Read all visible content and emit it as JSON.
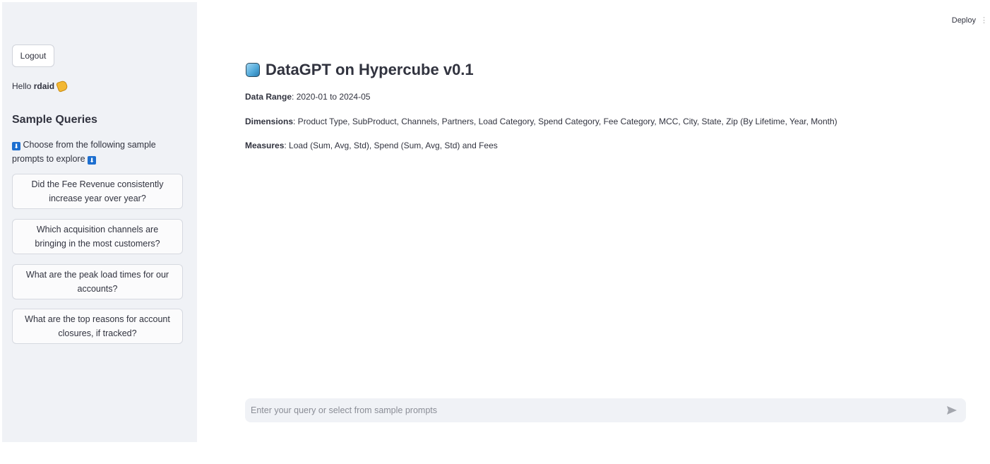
{
  "header": {
    "deploy_label": "Deploy",
    "menu_glyph": "⋮"
  },
  "sidebar": {
    "logout_label": "Logout",
    "greeting_prefix": "Hello ",
    "username": "rdaid",
    "greeting_icon": "waving-hand-icon",
    "section_title": "Sample Queries",
    "instruction_icon": "down-arrow-icon",
    "instruction": " Choose from the following sample prompts to explore ",
    "sample_prompts": [
      "Did the Fee Revenue consistently increase year over year?",
      "Which acquisition channels are bringing in the most customers?",
      "What are the peak load times for our accounts?",
      "What are the top reasons for account closures, if tracked?"
    ]
  },
  "main": {
    "title_icon": "cube-icon",
    "title": "DataGPT on Hypercube v0.1",
    "data_range_label": "Data Range",
    "data_range_value": ": 2020-01 to 2024-05",
    "dimensions_label": "Dimensions",
    "dimensions_value": ": Product Type, SubProduct, Channels, Partners, Load Category, Spend Category, Fee Category, MCC, City, State, Zip (By Lifetime, Year, Month)",
    "measures_label": "Measures",
    "measures_value": ": Load (Sum, Avg, Std), Spend (Sum, Avg, Std) and Fees"
  },
  "query": {
    "placeholder": "Enter your query or select from sample prompts",
    "value": "",
    "send_icon": "send-icon"
  },
  "colors": {
    "sidebar_bg": "#f0f2f6",
    "text": "#31333f",
    "input_bg": "#f0f2f6"
  }
}
